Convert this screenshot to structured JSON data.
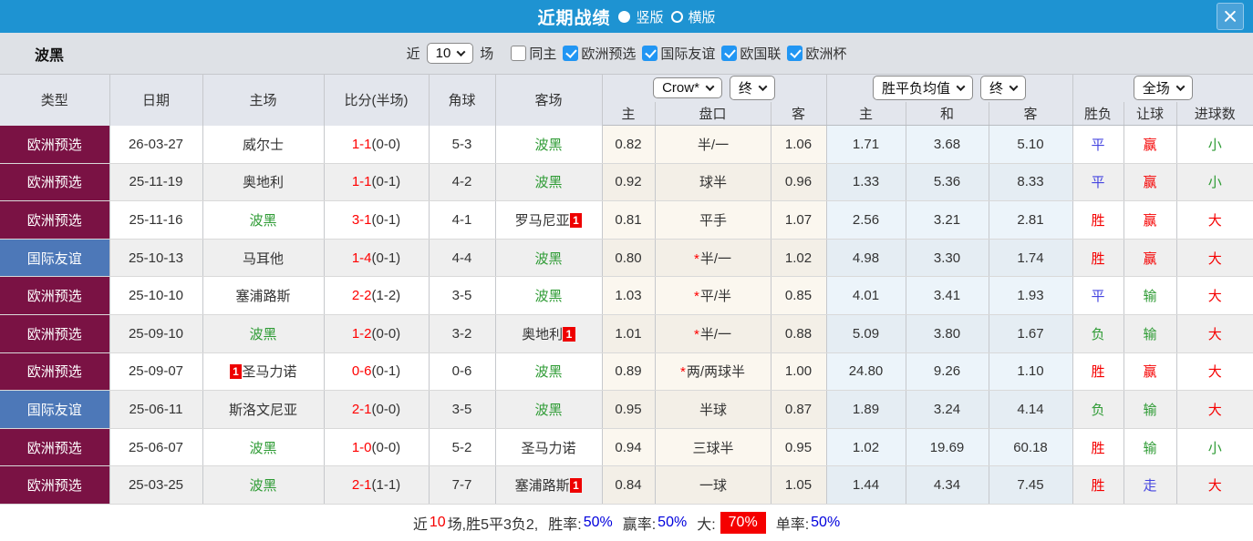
{
  "colors": {
    "title_bar": "#1e93d2",
    "type_qualifier": "#7a1244",
    "type_friendly": "#4d78b8",
    "accent_red": "#ff0000",
    "team_green": "#2e9b34",
    "rate_blue": "#0000dd"
  },
  "title_bar": {
    "title": "近期战绩",
    "radio_vertical": "竖版",
    "radio_horizontal": "横版"
  },
  "filter_bar": {
    "team": "波黑",
    "recent_label": "近",
    "recent_value": "10",
    "matches_label": "场",
    "same_home_label": "同主",
    "leagues": [
      {
        "label": "欧洲预选",
        "checked": true
      },
      {
        "label": "国际友谊",
        "checked": true
      },
      {
        "label": "欧国联",
        "checked": true
      },
      {
        "label": "欧洲杯",
        "checked": true
      }
    ]
  },
  "table": {
    "left_headers": [
      "类型",
      "日期",
      "主场",
      "比分(半场)",
      "角球",
      "客场"
    ],
    "group_odds": {
      "book_select": "Crow*",
      "time_select": "终",
      "cols": [
        "主",
        "盘口",
        "客"
      ]
    },
    "group_avg": {
      "type_select": "胜平负均值",
      "time_select": "终",
      "cols": [
        "主",
        "和",
        "客"
      ]
    },
    "group_result": {
      "scope_select": "全场",
      "cols": [
        "胜负",
        "让球",
        "进球数"
      ]
    },
    "rows": [
      {
        "type": "欧洲预选",
        "tcls": "type t-purple",
        "date": "26-03-27",
        "hbadge": "",
        "home": "威尔士",
        "hcls": "team",
        "score": "1-1",
        "half": "(0-0)",
        "corner": "5-3",
        "away": "波黑",
        "acls": "team c-green",
        "abadge": "",
        "oh": "0.82",
        "star": "",
        "hcap": "半/一",
        "oa": "1.06",
        "ah": "1.71",
        "ad": "3.68",
        "aa": "5.10",
        "spf": "平",
        "spfc": "c-blue",
        "rq": "赢",
        "rqc": "c-red",
        "jq": "小",
        "jqc": "c-green"
      },
      {
        "type": "欧洲预选",
        "tcls": "type t-purple",
        "date": "25-11-19",
        "hbadge": "",
        "home": "奥地利",
        "hcls": "team",
        "score": "1-1",
        "half": "(0-1)",
        "corner": "4-2",
        "away": "波黑",
        "acls": "team c-green",
        "abadge": "",
        "oh": "0.92",
        "star": "",
        "hcap": "球半",
        "oa": "0.96",
        "ah": "1.33",
        "ad": "5.36",
        "aa": "8.33",
        "spf": "平",
        "spfc": "c-blue",
        "rq": "赢",
        "rqc": "c-red",
        "jq": "小",
        "jqc": "c-green"
      },
      {
        "type": "欧洲预选",
        "tcls": "type t-purple",
        "date": "25-11-16",
        "hbadge": "",
        "home": "波黑",
        "hcls": "team c-green",
        "score": "3-1",
        "half": "(0-1)",
        "corner": "4-1",
        "away": "罗马尼亚",
        "acls": "team",
        "abadge": "1",
        "oh": "0.81",
        "star": "",
        "hcap": "平手",
        "oa": "1.07",
        "ah": "2.56",
        "ad": "3.21",
        "aa": "2.81",
        "spf": "胜",
        "spfc": "c-red",
        "rq": "赢",
        "rqc": "c-red",
        "jq": "大",
        "jqc": "c-red"
      },
      {
        "type": "国际友谊",
        "tcls": "type t-blue",
        "date": "25-10-13",
        "hbadge": "",
        "home": "马耳他",
        "hcls": "team",
        "score": "1-4",
        "half": "(0-1)",
        "corner": "4-4",
        "away": "波黑",
        "acls": "team c-green",
        "abadge": "",
        "oh": "0.80",
        "star": "*",
        "hcap": "半/一",
        "oa": "1.02",
        "ah": "4.98",
        "ad": "3.30",
        "aa": "1.74",
        "spf": "胜",
        "spfc": "c-red",
        "rq": "赢",
        "rqc": "c-red",
        "jq": "大",
        "jqc": "c-red"
      },
      {
        "type": "欧洲预选",
        "tcls": "type t-purple",
        "date": "25-10-10",
        "hbadge": "",
        "home": "塞浦路斯",
        "hcls": "team",
        "score": "2-2",
        "half": "(1-2)",
        "corner": "3-5",
        "away": "波黑",
        "acls": "team c-green",
        "abadge": "",
        "oh": "1.03",
        "star": "*",
        "hcap": "平/半",
        "oa": "0.85",
        "ah": "4.01",
        "ad": "3.41",
        "aa": "1.93",
        "spf": "平",
        "spfc": "c-blue",
        "rq": "输",
        "rqc": "c-green",
        "jq": "大",
        "jqc": "c-red"
      },
      {
        "type": "欧洲预选",
        "tcls": "type t-purple",
        "date": "25-09-10",
        "hbadge": "",
        "home": "波黑",
        "hcls": "team c-green",
        "score": "1-2",
        "half": "(0-0)",
        "corner": "3-2",
        "away": "奥地利",
        "acls": "team",
        "abadge": "1",
        "oh": "1.01",
        "star": "*",
        "hcap": "半/一",
        "oa": "0.88",
        "ah": "5.09",
        "ad": "3.80",
        "aa": "1.67",
        "spf": "负",
        "spfc": "c-green",
        "rq": "输",
        "rqc": "c-green",
        "jq": "大",
        "jqc": "c-red"
      },
      {
        "type": "欧洲预选",
        "tcls": "type t-purple",
        "date": "25-09-07",
        "hbadge": "1",
        "home": "圣马力诺",
        "hcls": "team",
        "score": "0-6",
        "half": "(0-1)",
        "corner": "0-6",
        "away": "波黑",
        "acls": "team c-green",
        "abadge": "",
        "oh": "0.89",
        "star": "*",
        "hcap": "两/两球半",
        "oa": "1.00",
        "ah": "24.80",
        "ad": "9.26",
        "aa": "1.10",
        "spf": "胜",
        "spfc": "c-red",
        "rq": "赢",
        "rqc": "c-red",
        "jq": "大",
        "jqc": "c-red"
      },
      {
        "type": "国际友谊",
        "tcls": "type t-blue",
        "date": "25-06-11",
        "hbadge": "",
        "home": "斯洛文尼亚",
        "hcls": "team",
        "score": "2-1",
        "half": "(0-0)",
        "corner": "3-5",
        "away": "波黑",
        "acls": "team c-green",
        "abadge": "",
        "oh": "0.95",
        "star": "",
        "hcap": "半球",
        "oa": "0.87",
        "ah": "1.89",
        "ad": "3.24",
        "aa": "4.14",
        "spf": "负",
        "spfc": "c-green",
        "rq": "输",
        "rqc": "c-green",
        "jq": "大",
        "jqc": "c-red"
      },
      {
        "type": "欧洲预选",
        "tcls": "type t-purple",
        "date": "25-06-07",
        "hbadge": "",
        "home": "波黑",
        "hcls": "team c-green",
        "score": "1-0",
        "half": "(0-0)",
        "corner": "5-2",
        "away": "圣马力诺",
        "acls": "team",
        "abadge": "",
        "oh": "0.94",
        "star": "",
        "hcap": "三球半",
        "oa": "0.95",
        "ah": "1.02",
        "ad": "19.69",
        "aa": "60.18",
        "spf": "胜",
        "spfc": "c-red",
        "rq": "输",
        "rqc": "c-green",
        "jq": "小",
        "jqc": "c-green"
      },
      {
        "type": "欧洲预选",
        "tcls": "type t-purple",
        "date": "25-03-25",
        "hbadge": "",
        "home": "波黑",
        "hcls": "team c-green",
        "score": "2-1",
        "half": "(1-1)",
        "corner": "7-7",
        "away": "塞浦路斯",
        "acls": "team",
        "abadge": "1",
        "oh": "0.84",
        "star": "",
        "hcap": "一球",
        "oa": "1.05",
        "ah": "1.44",
        "ad": "4.34",
        "aa": "7.45",
        "spf": "胜",
        "spfc": "c-red",
        "rq": "走",
        "rqc": "c-blue",
        "jq": "大",
        "jqc": "c-red"
      }
    ]
  },
  "footer": {
    "prefix": "近",
    "count": "10",
    "summary": "场,胜5平3负2,",
    "win_rate_label": "胜率:",
    "win_rate": "50%",
    "cover_rate_label": "赢率:",
    "cover_rate": "50%",
    "big_label": "大:",
    "big_rate": "70%",
    "single_rate_label": "单率:",
    "single_rate": "50%"
  }
}
